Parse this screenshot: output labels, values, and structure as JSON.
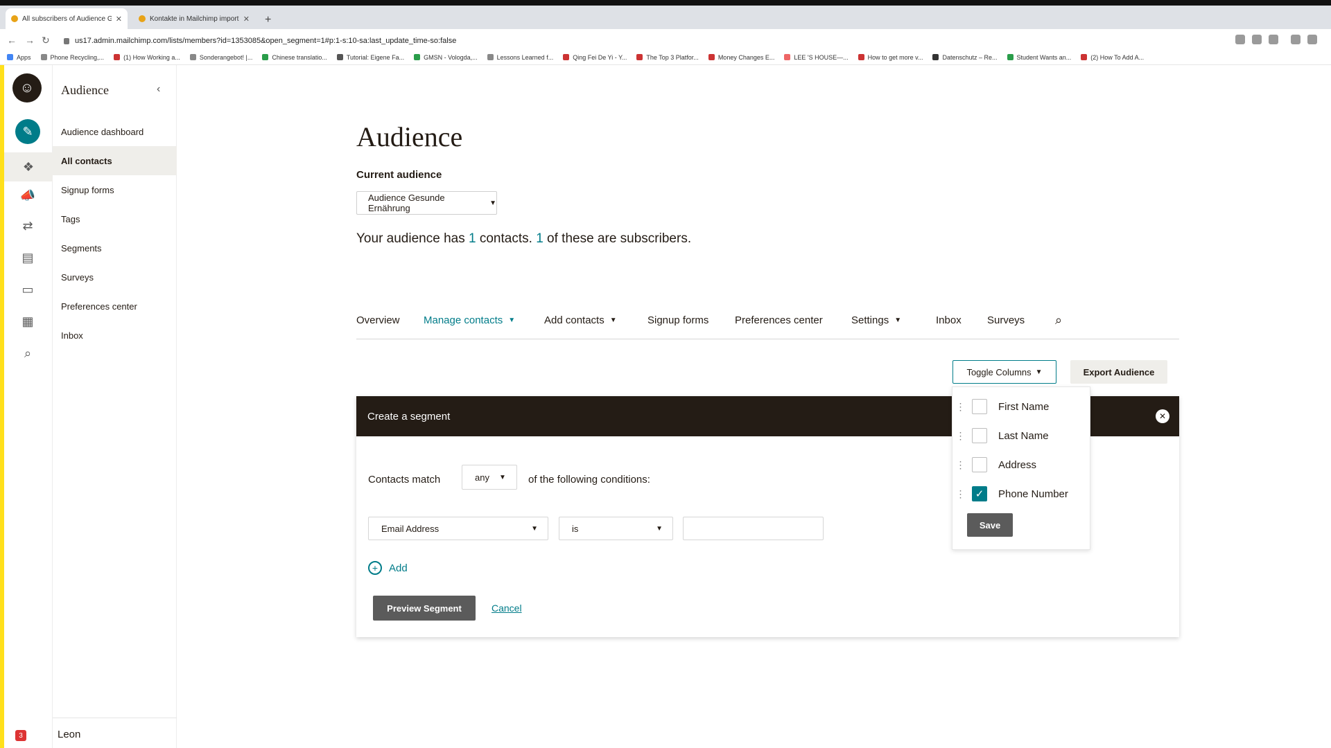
{
  "browser": {
    "tabs": [
      {
        "title": "All subscribers of Audience G"
      },
      {
        "title": "Kontakte in Mailchimp importi"
      }
    ],
    "url": "us17.admin.mailchimp.com/lists/members?id=1353085&open_segment=1#p:1-s:10-sa:last_update_time-so:false",
    "bookmarks": [
      "Apps",
      "Phone Recycling,...",
      "(1) How Working a...",
      "Sonderangebot! |...",
      "Chinese translatio...",
      "Tutorial: Eigene Fa...",
      "GMSN - Vologda,...",
      "Lessons Learned f...",
      "Qing Fei De Yi - Y...",
      "The Top 3 Platfor...",
      "Money Changes E...",
      "LEE 'S HOUSE—...",
      "How to get more v...",
      "Datenschutz – Re...",
      "Student Wants an...",
      "(2) How To Add A..."
    ]
  },
  "sidenav": {
    "title": "Audience",
    "items": [
      {
        "label": "Audience dashboard"
      },
      {
        "label": "All contacts"
      },
      {
        "label": "Signup forms"
      },
      {
        "label": "Tags"
      },
      {
        "label": "Segments"
      },
      {
        "label": "Surveys"
      },
      {
        "label": "Preferences center"
      },
      {
        "label": "Inbox"
      }
    ],
    "user": "Leon",
    "badge": "3"
  },
  "main": {
    "title": "Audience",
    "current_audience_label": "Current audience",
    "audience_select": "Audience Gesunde Ernährung",
    "summary": {
      "prefix": "Your audience has",
      "contacts": "1",
      "middle": "contacts.",
      "subscribers": "1",
      "suffix": "of these are subscribers."
    },
    "tabs": [
      {
        "label": "Overview"
      },
      {
        "label": "Manage contacts"
      },
      {
        "label": "Add contacts"
      },
      {
        "label": "Signup forms"
      },
      {
        "label": "Preferences center"
      },
      {
        "label": "Settings"
      },
      {
        "label": "Inbox"
      },
      {
        "label": "Surveys"
      }
    ],
    "toggle_columns": "Toggle Columns",
    "export_audience": "Export Audience"
  },
  "segment": {
    "title": "Create a segment",
    "match_label": "Contacts match",
    "match_value": "any",
    "match_tail": "of the following conditions:",
    "field": "Email Address",
    "operator": "is",
    "value": "",
    "add_label": "Add",
    "preview_label": "Preview Segment",
    "cancel_label": "Cancel"
  },
  "columns_dropdown": {
    "items": [
      {
        "label": "First Name",
        "checked": false
      },
      {
        "label": "Last Name",
        "checked": false
      },
      {
        "label": "Address",
        "checked": false
      },
      {
        "label": "Phone Number",
        "checked": true
      }
    ],
    "save_label": "Save"
  },
  "colors": {
    "accent": "#007c89",
    "dark": "#241c15",
    "brand_yellow": "#ffe01b"
  }
}
